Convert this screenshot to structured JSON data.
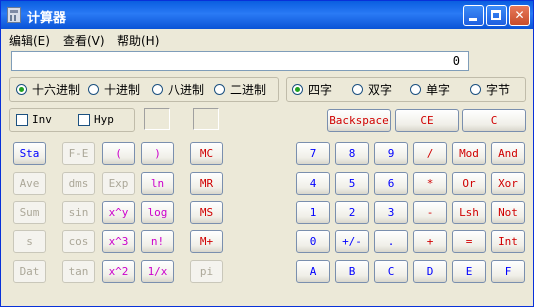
{
  "window": {
    "title": "计算器"
  },
  "menu": {
    "edit": "编辑(E)",
    "view": "查看(V)",
    "help": "帮助(H)"
  },
  "display": {
    "value": "0"
  },
  "base": {
    "hex": "十六进制",
    "dec": "十进制",
    "oct": "八进制",
    "bin": "二进制",
    "selected": "hex"
  },
  "word": {
    "qword": "四字",
    "dword": "双字",
    "word": "单字",
    "byte": "字节",
    "selected": "qword"
  },
  "checks": {
    "inv": "Inv",
    "hyp": "Hyp"
  },
  "edit_buttons": {
    "backspace": "Backspace",
    "ce": "CE",
    "c": "C"
  },
  "sci_buttons": [
    [
      "Sta",
      "F-E",
      "(",
      ")"
    ],
    [
      "Ave",
      "dms",
      "Exp",
      "ln"
    ],
    [
      "Sum",
      "sin",
      "x^y",
      "log"
    ],
    [
      "s",
      "cos",
      "x^3",
      "n!"
    ],
    [
      "Dat",
      "tan",
      "x^2",
      "1/x"
    ]
  ],
  "memory_buttons": [
    "MC",
    "MR",
    "MS",
    "M+",
    "pi"
  ],
  "keypad": [
    [
      "7",
      "8",
      "9",
      "/",
      "Mod",
      "And"
    ],
    [
      "4",
      "5",
      "6",
      "*",
      "Or",
      "Xor"
    ],
    [
      "1",
      "2",
      "3",
      "-",
      "Lsh",
      "Not"
    ],
    [
      "0",
      "+/-",
      ".",
      "+",
      "=",
      "Int"
    ],
    [
      "A",
      "B",
      "C",
      "D",
      "E",
      "F"
    ]
  ],
  "colors": {
    "title_bar": "#0a5ee0",
    "window_bg": "#ece9d8",
    "blue_text": "#0000ff",
    "red_text": "#d00000",
    "magenta_text": "#cc00cc",
    "disabled_text": "#aca899"
  }
}
